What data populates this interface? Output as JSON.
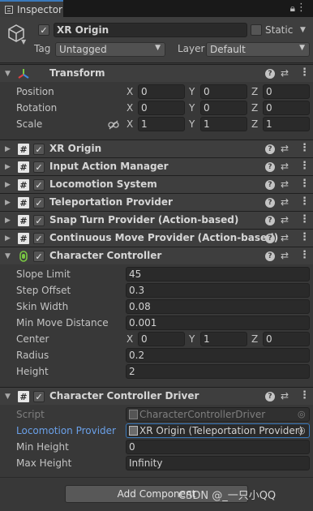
{
  "tab": {
    "label": "Inspector"
  },
  "header": {
    "object_name": "XR Origin",
    "static_label": "Static",
    "tag_label": "Tag",
    "tag_value": "Untagged",
    "layer_label": "Layer",
    "layer_value": "Default"
  },
  "transform": {
    "title": "Transform",
    "rows": [
      {
        "label": "Position",
        "x": "0",
        "y": "0",
        "z": "0"
      },
      {
        "label": "Rotation",
        "x": "0",
        "y": "0",
        "z": "0"
      },
      {
        "label": "Scale",
        "x": "1",
        "y": "1",
        "z": "1"
      }
    ]
  },
  "axes": {
    "x": "X",
    "y": "Y",
    "z": "Z"
  },
  "components": [
    {
      "title": "XR Origin"
    },
    {
      "title": "Input Action Manager"
    },
    {
      "title": "Locomotion System"
    },
    {
      "title": "Teleportation Provider"
    },
    {
      "title": "Snap Turn Provider (Action-based)"
    },
    {
      "title": "Continuous Move Provider (Action-based)"
    }
  ],
  "character_controller": {
    "title": "Character Controller",
    "slope_limit_label": "Slope Limit",
    "slope_limit": "45",
    "step_offset_label": "Step Offset",
    "step_offset": "0.3",
    "skin_width_label": "Skin Width",
    "skin_width": "0.08",
    "min_move_label": "Min Move Distance",
    "min_move": "0.001",
    "center_label": "Center",
    "center_x": "0",
    "center_y": "1",
    "center_z": "0",
    "radius_label": "Radius",
    "radius": "0.2",
    "height_label": "Height",
    "height": "2"
  },
  "driver": {
    "title": "Character Controller Driver",
    "script_label": "Script",
    "script_value": "CharacterControllerDriver",
    "locomotion_label": "Locomotion Provider",
    "locomotion_value": "XR Origin (Teleportation Provider)",
    "min_height_label": "Min Height",
    "min_height": "0",
    "max_height_label": "Max Height",
    "max_height": "Infinity"
  },
  "add_component_label": "Add Component",
  "watermark": "CSDN @_一只小QQ"
}
